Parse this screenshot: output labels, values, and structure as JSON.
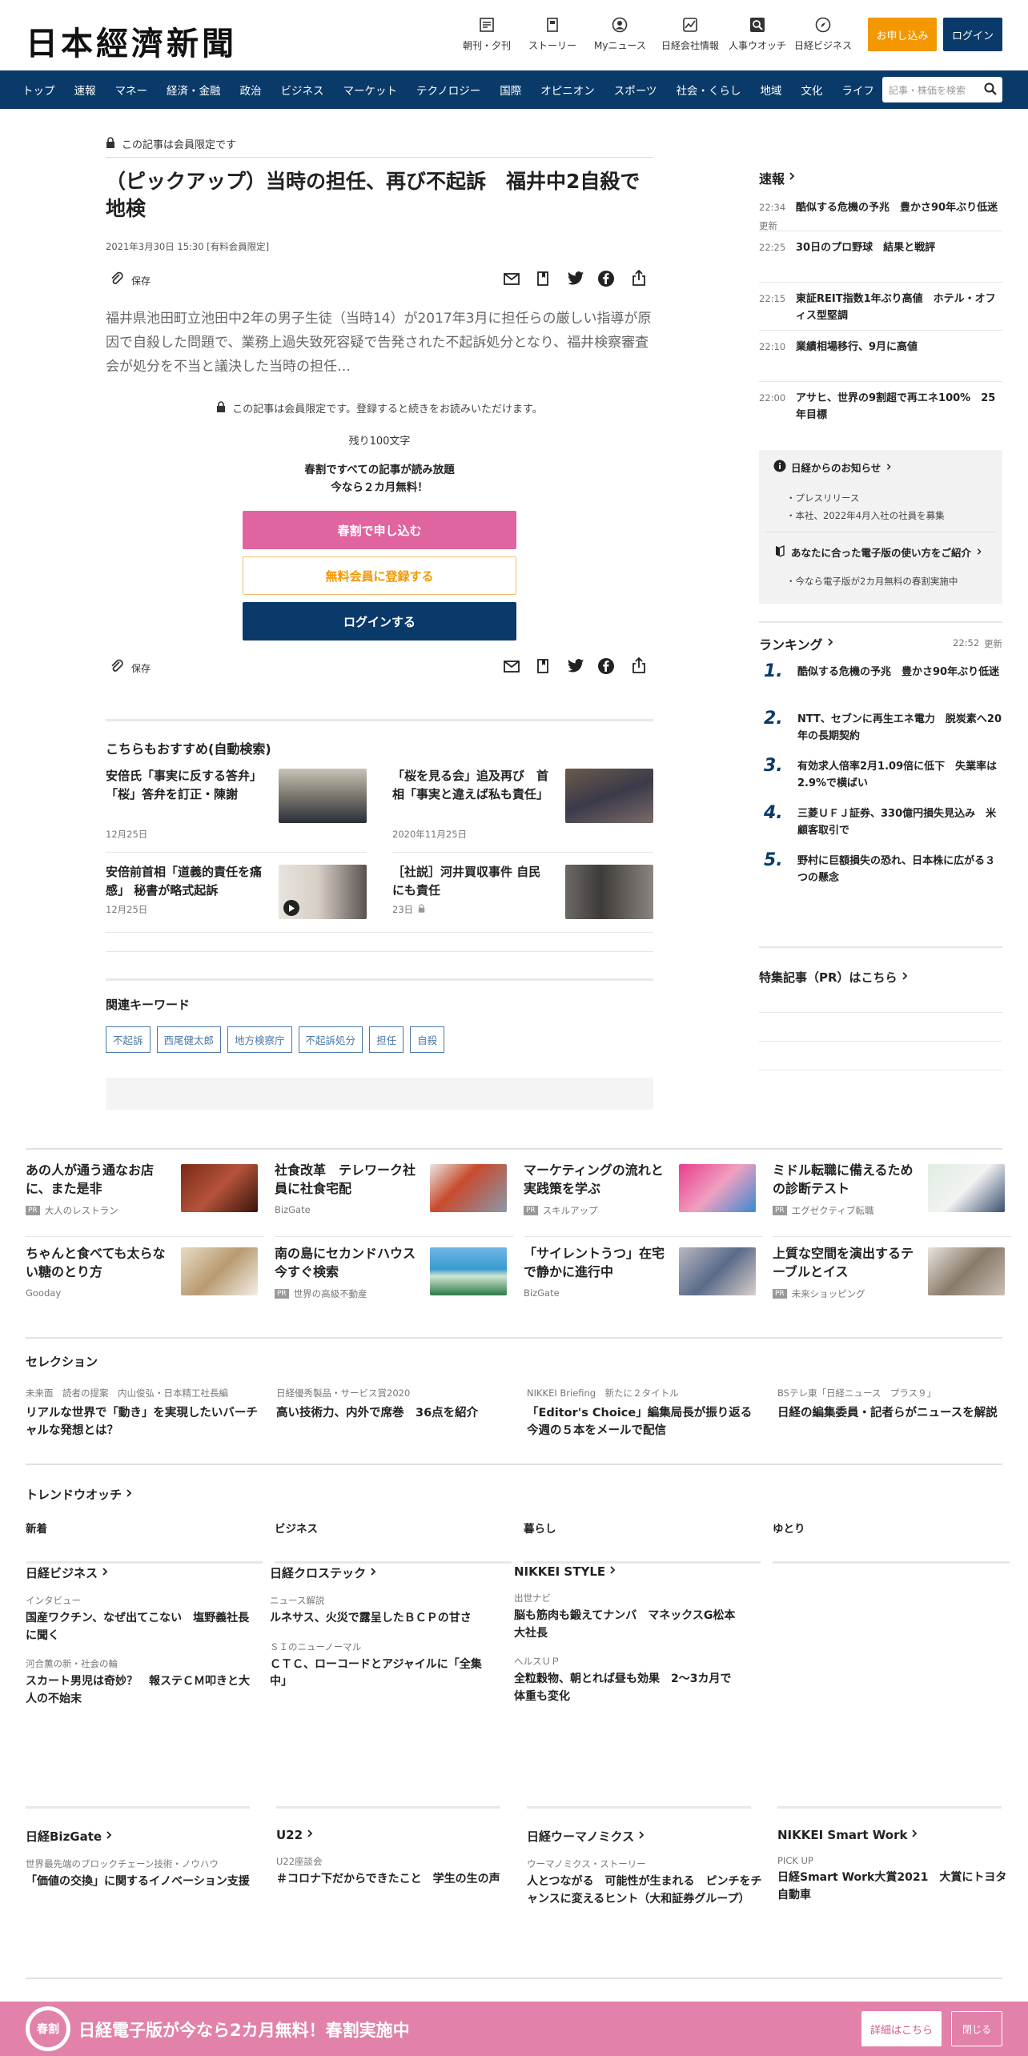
{
  "header": {
    "logo": "日本經濟新聞",
    "nav": [
      {
        "label": "朝刊・夕刊",
        "icon": "newspaper-icon"
      },
      {
        "label": "ストーリー",
        "icon": "story-icon"
      },
      {
        "label": "Myニュース",
        "icon": "user-icon"
      },
      {
        "label": "日経会社情報",
        "icon": "chart-icon"
      },
      {
        "label": "人事ウオッチ",
        "icon": "search-person-icon"
      },
      {
        "label": "日経ビジネス",
        "icon": "compass-icon"
      }
    ],
    "apply_label": "お申し込み",
    "login_label": "ログイン",
    "accent": "#f39800",
    "navy": "#0a3a6a"
  },
  "global_nav": [
    "トップ",
    "速報",
    "マネー",
    "経済・金融",
    "政治",
    "ビジネス",
    "マーケット",
    "テクノロジー",
    "国際",
    "オピニオン",
    "スポーツ",
    "社会・くらし",
    "地域",
    "文化",
    "ライフ"
  ],
  "search": {
    "placeholder": "記事・株価を検索"
  },
  "article": {
    "member_only": "この記事は会員限定です",
    "title": "（ピックアップ）当時の担任、再び不起訴　福井中2自殺で地検",
    "date": "2021年3月30日 15:30 [有料会員限定]",
    "save_label": "保存",
    "lead": "福井県池田町立池田中2年の男子生徒（当時14）が2017年3月に担任らの厳しい指導が原因で自殺した問題で、業務上過失致死容疑で告発された不起訴処分となり、福井検察審査会が処分を不当と議決した当時の担任…",
    "paywall_note": "この記事は会員限定です。登録すると続きをお読みいただけます。",
    "remaining": "残り100文字",
    "promo_line1": "春割ですべての記事が読み放題",
    "promo_line2": "今なら２カ月無料！",
    "cta_spring": "春割で申し込む",
    "cta_free": "無料会員に登録する",
    "cta_login": "ログインする"
  },
  "recommend": {
    "heading": "こちらもおすすめ(自動検索)",
    "items": [
      {
        "title": "安倍氏「事実に反する答弁」「桜」答弁を訂正・陳謝",
        "date": "12月25日"
      },
      {
        "title": "「桜を見る会」追及再び　首相「事実と違えば私も責任」",
        "date": "2020年11月25日"
      },
      {
        "title": "安倍前首相「道義的責任を痛感」 秘書が略式起訴",
        "date": "12月25日"
      },
      {
        "title": "［社説］河井買収事件 自民にも責任",
        "date": "23日"
      }
    ]
  },
  "keywords": {
    "heading": "関連キーワード",
    "items": [
      "不起訴",
      "西尾健太郎",
      "地方検察庁",
      "不起訴処分",
      "担任",
      "自殺"
    ]
  },
  "sidebar": {
    "flash_heading": "速報",
    "flash": [
      {
        "time": "22:34",
        "text": "酷似する危機の予兆　豊かさ90年ぶり低迷",
        "updated": "更新"
      },
      {
        "time": "22:25",
        "text": "30日のプロ野球　結果と戦評"
      },
      {
        "time": "22:15",
        "text": "東証REIT指数1年ぶり高値　ホテル・オフィス型堅調"
      },
      {
        "time": "22:10",
        "text": "業績相場移行、9月に高値"
      },
      {
        "time": "22:00",
        "text": "アサヒ、世界の9割超で再エネ100%　25年目標"
      }
    ],
    "notice_heading": "日経からのお知らせ",
    "notices": [
      "プレスリリース",
      "本社、2022年4月入社の社員を募集"
    ],
    "guide_heading": "あなたに合った電子版の使い方をご紹介",
    "guides": [
      "今なら電子版が2カ月無料の春割実施中"
    ],
    "ranking_heading": "ランキング",
    "ranking_time": "22:52",
    "ranking_updated": "更新",
    "ranking": [
      {
        "n": "1.",
        "text": "酷似する危機の予兆　豊かさ90年ぶり低迷"
      },
      {
        "n": "2.",
        "text": "NTT、セブンに再生エネ電力　脱炭素へ20年の長期契約"
      },
      {
        "n": "3.",
        "text": "有効求人倍率2月1.09倍に低下　失業率は2.9%で横ばい"
      },
      {
        "n": "4.",
        "text": "三菱ＵＦＪ証券、330億円損失見込み　米顧客取引で"
      },
      {
        "n": "5.",
        "text": "野村に巨額損失の恐れ、日本株に広がる３つの懸念"
      }
    ],
    "feature_heading": "特集記事（PR）はこちら"
  },
  "ads": [
    {
      "title": "あの人が通う通なお店に、また是非",
      "sponsor": "大人のレストラン",
      "pr": true
    },
    {
      "title": "社食改革　テレワーク社員に社食宅配",
      "sponsor": "BizGate",
      "pr": false
    },
    {
      "title": "マーケティングの流れと実践策を学ぶ",
      "sponsor": "スキルアップ",
      "pr": true
    },
    {
      "title": "ミドル転職に備えるための診断テスト",
      "sponsor": "エグゼクティブ転職",
      "pr": true
    },
    {
      "title": "ちゃんと食べても太らない糖のとり方",
      "sponsor": "Gooday",
      "pr": false
    },
    {
      "title": "南の島にセカンドハウス　今すぐ検索",
      "sponsor": "世界の高級不動産",
      "pr": true
    },
    {
      "title": "「サイレントうつ」在宅で静かに進行中",
      "sponsor": "BizGate",
      "pr": false
    },
    {
      "title": "上質な空間を演出するテーブルとイス",
      "sponsor": "未来ショッピング",
      "pr": true
    }
  ],
  "pr_label": "PR",
  "selection": {
    "heading": "セレクション",
    "items": [
      {
        "sub": "未来面　読者の提案　内山俊弘・日本精工社長編",
        "title": "リアルな世界で「動き」を実現したいバーチャルな発想とは？"
      },
      {
        "sub": "日経優秀製品・サービス賞2020",
        "title": "高い技術力、内外で席巻　36点を紹介"
      },
      {
        "sub": "NIKKEI Briefing　新たに２タイトル",
        "title": "「Editor's Choice」編集局長が振り返る今週の５本をメールで配信"
      },
      {
        "sub": "BSテレ東「日経ニュース　プラス９」",
        "title": "日経の編集委員・記者らがニュースを解説"
      }
    ]
  },
  "trend": {
    "heading": "トレンドウオッチ",
    "tabs": [
      "新着",
      "ビジネス",
      "暮らし",
      "ゆとり"
    ]
  },
  "media1": [
    {
      "heading": "日経ビジネス",
      "items": [
        {
          "cat": "インタビュー",
          "title": "国産ワクチン、なぜ出てこない　塩野義社長に聞く"
        },
        {
          "cat": "河合薫の新・社会の輪",
          "title": "スカート男児は奇妙？　報ステＣＭ叩きと大人の不始末"
        }
      ]
    },
    {
      "heading": "日経クロステック",
      "items": [
        {
          "cat": "ニュース解説",
          "title": "ルネサス、火災で露呈したＢＣＰの甘さ"
        },
        {
          "cat": "ＳＩのニューノーマル",
          "title": "ＣＴＣ、ローコードとアジャイルに「全集中」"
        }
      ]
    },
    {
      "heading": "NIKKEI STYLE",
      "items": [
        {
          "cat": "出世ナビ",
          "title": "脳も筋肉も鍛えてナンバ　マネックスG松本大社長"
        },
        {
          "cat": "ヘルスＵＰ",
          "title": "全粒穀物、朝とれば昼も効果　2～3カ月で体重も変化"
        }
      ]
    }
  ],
  "media2": [
    {
      "heading": "日経BizGate",
      "cat": "世界最先端のブロックチェーン技術・ノウハウ",
      "title": "「価値の交換」に関するイノベーション支援"
    },
    {
      "heading": "U22",
      "cat": "U22座談会",
      "title": "＃コロナ下だからできたこと　学生の生の声"
    },
    {
      "heading": "日経ウーマノミクス",
      "cat": "ウーマノミクス・ストーリー",
      "title": "人とつながる　可能性が生まれる　ピンチをチャンスに変えるヒント（大和証券グループ）"
    },
    {
      "heading": "NIKKEI Smart Work",
      "cat": "PICK UP",
      "title": "日経Smart Work大賞2021　大賞にトヨタ自動車"
    }
  ],
  "banner": {
    "badge": "春割",
    "text": "日経電子版が今なら2カ月無料！春割実施中",
    "detail": "詳細はこちら",
    "close": "閉じる",
    "color": "#e281a9"
  }
}
